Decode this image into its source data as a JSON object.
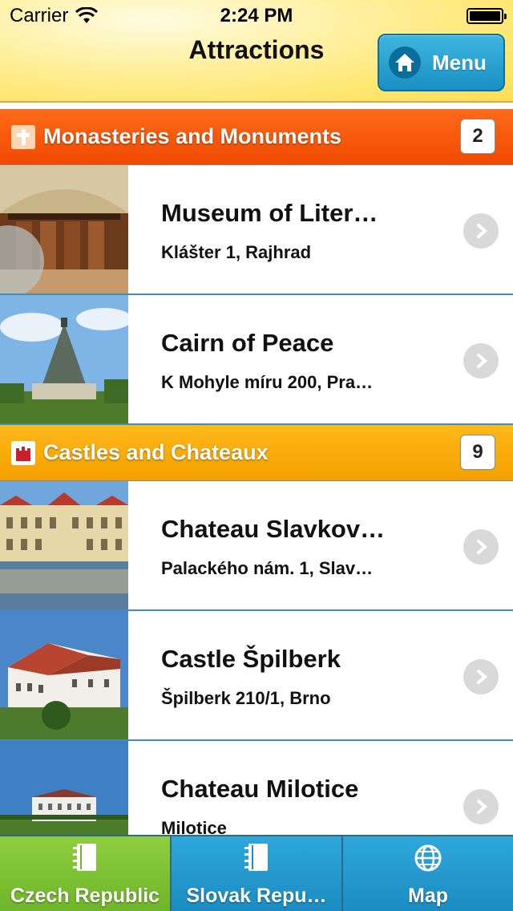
{
  "status_bar": {
    "carrier": "Carrier",
    "time": "2:24 PM"
  },
  "nav": {
    "title": "Attractions",
    "menu_label": "Menu"
  },
  "sections": [
    {
      "title": "Monasteries and Monuments",
      "count": "2",
      "icon": "cross-icon",
      "color": "#f04a00",
      "items": [
        {
          "title": "Museum of Liter…",
          "address": "Klášter 1, Rajhrad",
          "thumb": "library-photo"
        },
        {
          "title": "Cairn of Peace",
          "address": "K Mohyle míru 200, Pra…",
          "thumb": "monument-photo"
        }
      ]
    },
    {
      "title": "Castles and Chateaux",
      "count": "9",
      "icon": "castle-icon",
      "color": "#f3a000",
      "items": [
        {
          "title": "Chateau Slavkov…",
          "address": "Palackého nám. 1, Slav…",
          "thumb": "chateau-photo"
        },
        {
          "title": "Castle Špilberk",
          "address": "Špilberk 210/1, Brno",
          "thumb": "castle-photo"
        },
        {
          "title": "Chateau Milotice",
          "address": "Milotice",
          "thumb": "milotice-photo"
        }
      ]
    }
  ],
  "tabs": [
    {
      "label": "Czech Republic",
      "icon": "notebook-icon",
      "active": true
    },
    {
      "label": "Slovak Repu…",
      "icon": "notebook-icon",
      "active": false
    },
    {
      "label": "Map",
      "icon": "globe-icon",
      "active": false
    }
  ],
  "colors": {
    "header_yellow": "#ffe774",
    "menu_blue": "#1a8fc3",
    "tab_active_green": "#6eb52a",
    "tab_inactive_blue": "#1a8cc1"
  }
}
